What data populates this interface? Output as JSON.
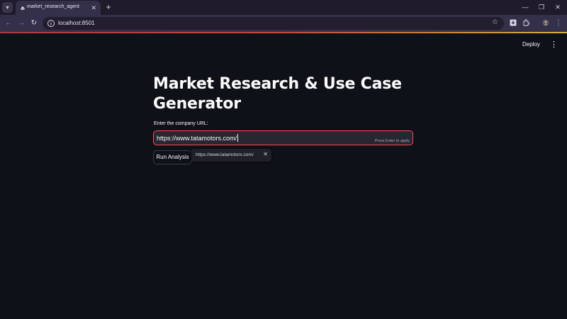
{
  "browser": {
    "tab": {
      "title": "market_research_agent",
      "close_icon": "close-icon",
      "favicon": "streamlit-favicon"
    },
    "tab_search_icon": "chevron-down-icon",
    "new_tab_icon": "plus-icon",
    "window_controls": [
      "minimize-icon",
      "restore-icon",
      "close-icon"
    ],
    "nav": {
      "back_icon": "arrow-left-icon",
      "forward_icon": "arrow-right-icon",
      "reload_icon": "reload-icon"
    },
    "address": "localhost:8501",
    "site_info_icon": "info-icon",
    "bookmark_icon": "star-icon",
    "toolbar_icons": [
      "download-icon",
      "extensions-icon",
      "profile-icon",
      "menu-dots-icon"
    ]
  },
  "app": {
    "header": {
      "deploy_label": "Deploy",
      "menu_icon": "vertical-dots-icon"
    },
    "title": "Market Research & Use Case Generator",
    "url_field": {
      "label": "Enter the company URL:",
      "value": "https://www.tatamotors.com/",
      "hint": "Press Enter to apply"
    },
    "run_button_label": "Run Analysis",
    "autofill_suggestion": {
      "text": "https://www.tatamotors.com/",
      "close_icon": "close-icon"
    }
  },
  "colors": {
    "background": "#0e1117",
    "input_background": "#262730",
    "input_focus_border": "#ff4b4b",
    "text": "#fafafa",
    "browser_frame": "#35304a"
  }
}
